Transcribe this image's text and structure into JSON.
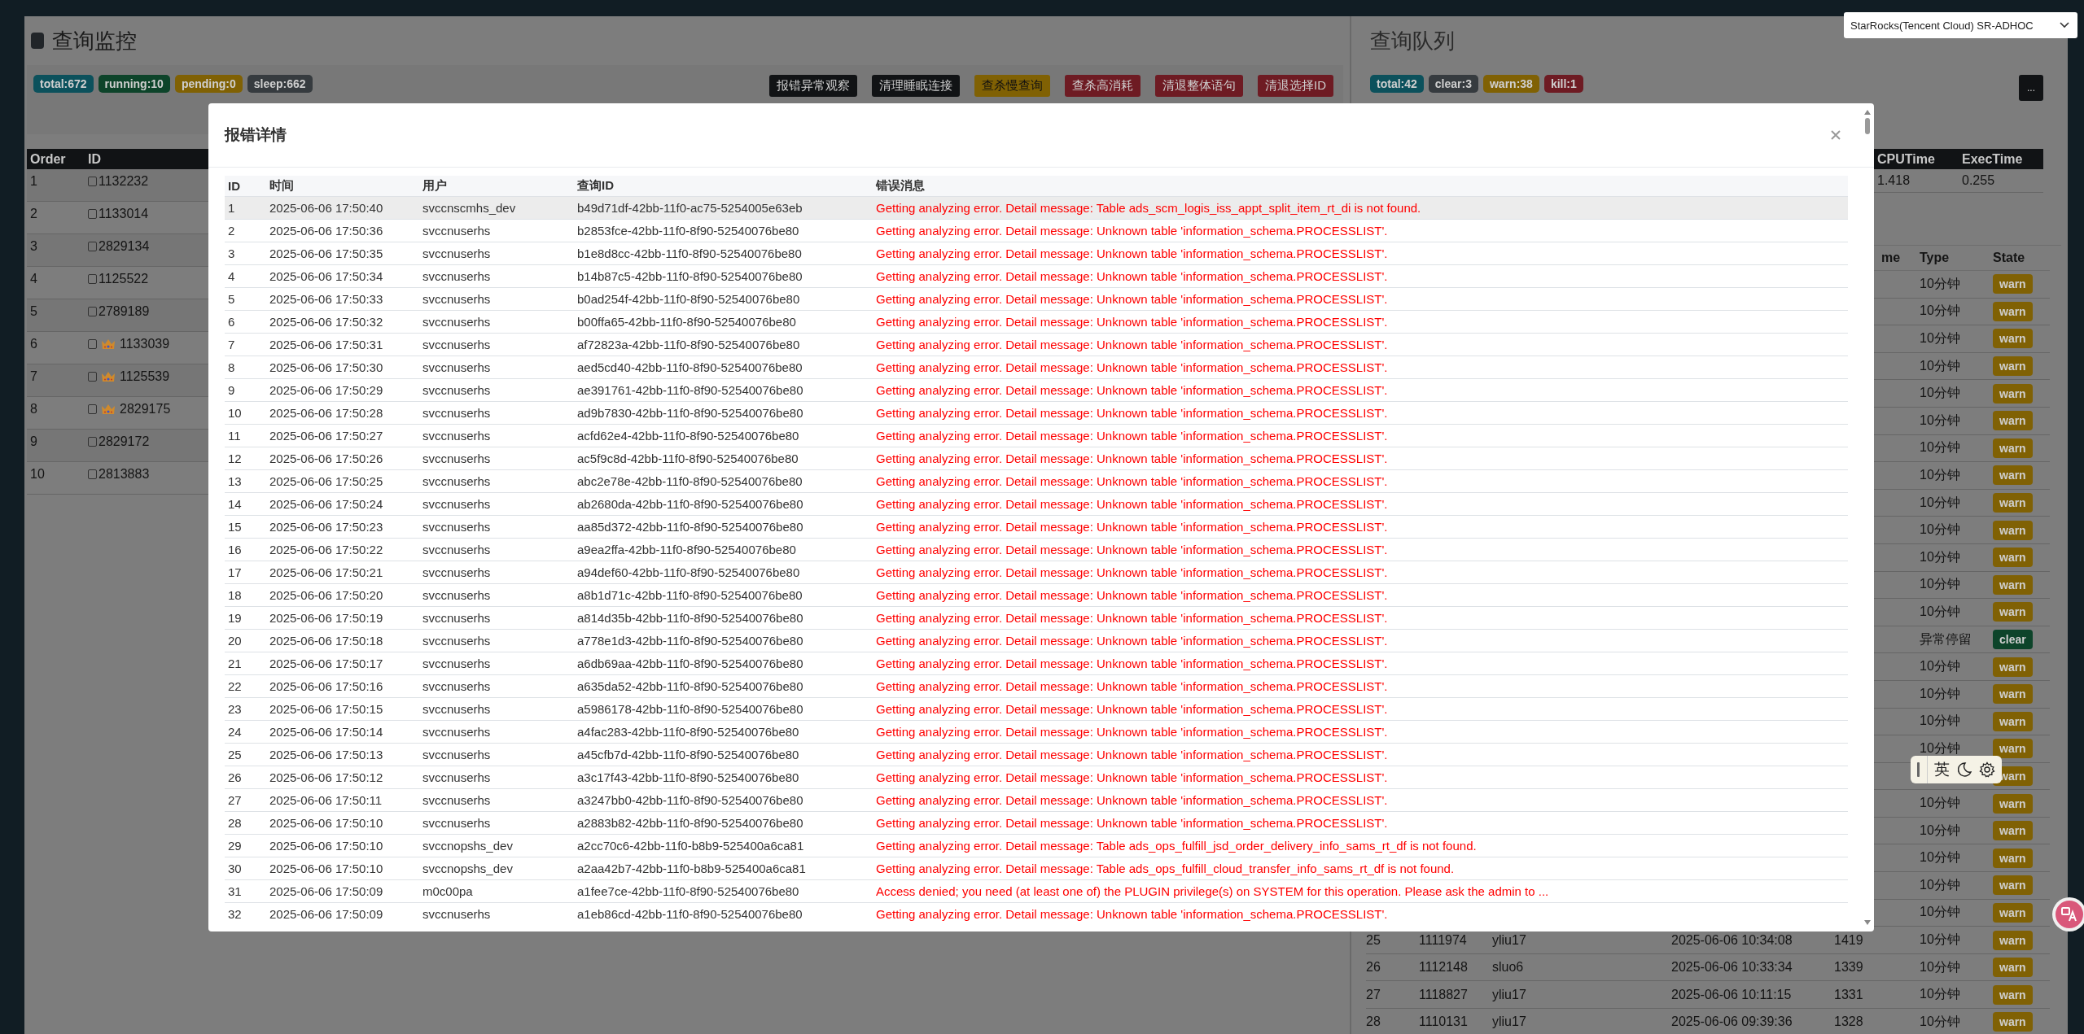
{
  "monitor": {
    "title": "查询监控",
    "badges": [
      {
        "label": "total:672",
        "color": "#0c515c"
      },
      {
        "label": "running:10",
        "color": "#0d442a"
      },
      {
        "label": "pending:0",
        "color": "#806104"
      },
      {
        "label": "sleep:662",
        "color": "#363b3f"
      }
    ],
    "buttons": [
      {
        "label": "报错异常观察",
        "color": "#111315"
      },
      {
        "label": "清理睡眠连接",
        "color": "#111315"
      },
      {
        "label": "查杀慢查询",
        "color": "#806104"
      },
      {
        "label": "查杀高消耗",
        "color": "#6e1b23"
      },
      {
        "label": "清退整体语句",
        "color": "#6e1b23"
      },
      {
        "label": "清退选择ID",
        "color": "#6e1b23"
      }
    ],
    "columns": [
      "Order",
      "ID"
    ],
    "rows": [
      {
        "order": "1",
        "id": "1132232",
        "checked": false,
        "crown": false
      },
      {
        "order": "2",
        "id": "1133014",
        "checked": false,
        "crown": false
      },
      {
        "order": "3",
        "id": "2829134",
        "checked": false,
        "crown": false
      },
      {
        "order": "4",
        "id": "1125522",
        "checked": false,
        "crown": false
      },
      {
        "order": "5",
        "id": "2789189",
        "checked": false,
        "crown": false
      },
      {
        "order": "6",
        "id": "1133039",
        "checked": false,
        "crown": true
      },
      {
        "order": "7",
        "id": "1125539",
        "checked": false,
        "crown": true
      },
      {
        "order": "8",
        "id": "2829175",
        "checked": false,
        "crown": true
      },
      {
        "order": "9",
        "id": "2829172",
        "checked": false,
        "crown": false
      },
      {
        "order": "10",
        "id": "2813883",
        "checked": false,
        "crown": false
      }
    ]
  },
  "queue": {
    "title": "查询队列",
    "badges": [
      {
        "label": "total:42",
        "color": "#0c515c"
      },
      {
        "label": "clear:3",
        "color": "#363b3f"
      },
      {
        "label": "warn:38",
        "color": "#806104"
      },
      {
        "label": "kill:1",
        "color": "#6e1b23"
      }
    ],
    "more_button": "...",
    "summary": {
      "columns": [
        "CPUTime",
        "ExecTime"
      ],
      "values": [
        "1.418",
        "0.255"
      ]
    },
    "columns": {
      "column_5": "me",
      "type": "Type",
      "state": "State"
    },
    "rows": [
      {
        "type": "10分钟",
        "state": "warn",
        "color": "#806104"
      },
      {
        "type": "10分钟",
        "state": "warn",
        "color": "#806104"
      },
      {
        "type": "10分钟",
        "state": "warn",
        "color": "#806104"
      },
      {
        "type": "10分钟",
        "state": "warn",
        "color": "#806104"
      },
      {
        "type": "10分钟",
        "state": "warn",
        "color": "#806104"
      },
      {
        "type": "10分钟",
        "state": "warn",
        "color": "#806104"
      },
      {
        "type": "10分钟",
        "state": "warn",
        "color": "#806104"
      },
      {
        "type": "10分钟",
        "state": "warn",
        "color": "#806104"
      },
      {
        "type": "10分钟",
        "state": "warn",
        "color": "#806104"
      },
      {
        "type": "10分钟",
        "state": "warn",
        "color": "#806104"
      },
      {
        "type": "10分钟",
        "state": "warn",
        "color": "#806104"
      },
      {
        "type": "10分钟",
        "state": "warn",
        "color": "#806104"
      },
      {
        "type": "10分钟",
        "state": "warn",
        "color": "#806104"
      },
      {
        "type": "异常停留",
        "state": "clear",
        "color": "#0d442a"
      },
      {
        "type": "10分钟",
        "state": "warn",
        "color": "#806104"
      },
      {
        "type": "10分钟",
        "state": "warn",
        "color": "#806104"
      },
      {
        "type": "10分钟",
        "state": "warn",
        "color": "#806104"
      },
      {
        "type": "10分钟",
        "state": "warn",
        "color": "#806104"
      },
      {
        "state": "warn",
        "color": "#806104"
      },
      {
        "type": "10分钟",
        "state": "warn",
        "color": "#806104"
      },
      {
        "type": "10分钟",
        "state": "warn",
        "color": "#806104"
      },
      {
        "type": "10分钟",
        "state": "warn",
        "color": "#806104"
      },
      {
        "type": "10分钟",
        "state": "warn",
        "color": "#806104"
      },
      {
        "type": "10分钟",
        "state": "warn",
        "color": "#806104"
      },
      {
        "order": "25",
        "id": "1111974",
        "user": "yliu17",
        "time": "2025-06-06 10:34:08",
        "column_5": "1419",
        "type": "10分钟",
        "state": "warn",
        "color": "#806104"
      },
      {
        "order": "26",
        "id": "1112148",
        "user": "sluo6",
        "time": "2025-06-06 10:33:34",
        "column_5": "1339",
        "type": "10分钟",
        "state": "warn",
        "color": "#806104"
      },
      {
        "order": "27",
        "id": "1118827",
        "user": "yliu17",
        "time": "2025-06-06 10:11:15",
        "column_5": "1331",
        "type": "10分钟",
        "state": "warn",
        "color": "#806104"
      },
      {
        "order": "28",
        "id": "1110131",
        "user": "yliu17",
        "time": "2025-06-06 09:39:36",
        "column_5": "1328",
        "type": "10分钟",
        "state": "warn",
        "color": "#806104"
      }
    ]
  },
  "cluster_select": {
    "value": "StarRocks(Tencent Cloud) SR-ADHOC"
  },
  "modal": {
    "title": "报错详情",
    "columns": [
      "ID",
      "时间",
      "用户",
      "查询ID",
      "错误消息"
    ],
    "rows": [
      {
        "id": "1",
        "time": "2025-06-06 17:50:40",
        "user": "svccnscmhs_dev",
        "query_id": "b49d71df-42bb-11f0-ac75-5254005e63eb",
        "message": "Getting analyzing error. Detail message: Table ads_scm_logis_iss_appt_split_item_rt_di is not found.",
        "selected": true
      },
      {
        "id": "2",
        "time": "2025-06-06 17:50:36",
        "user": "svccnuserhs",
        "query_id": "b2853fce-42bb-11f0-8f90-52540076be80",
        "message": "Getting analyzing error. Detail message: Unknown table 'information_schema.PROCESSLIST'.",
        "selected": false
      },
      {
        "id": "3",
        "time": "2025-06-06 17:50:35",
        "user": "svccnuserhs",
        "query_id": "b1e8d8cc-42bb-11f0-8f90-52540076be80",
        "message": "Getting analyzing error. Detail message: Unknown table 'information_schema.PROCESSLIST'.",
        "selected": false
      },
      {
        "id": "4",
        "time": "2025-06-06 17:50:34",
        "user": "svccnuserhs",
        "query_id": "b14b87c5-42bb-11f0-8f90-52540076be80",
        "message": "Getting analyzing error. Detail message: Unknown table 'information_schema.PROCESSLIST'.",
        "selected": false
      },
      {
        "id": "5",
        "time": "2025-06-06 17:50:33",
        "user": "svccnuserhs",
        "query_id": "b0ad254f-42bb-11f0-8f90-52540076be80",
        "message": "Getting analyzing error. Detail message: Unknown table 'information_schema.PROCESSLIST'.",
        "selected": false
      },
      {
        "id": "6",
        "time": "2025-06-06 17:50:32",
        "user": "svccnuserhs",
        "query_id": "b00ffa65-42bb-11f0-8f90-52540076be80",
        "message": "Getting analyzing error. Detail message: Unknown table 'information_schema.PROCESSLIST'.",
        "selected": false
      },
      {
        "id": "7",
        "time": "2025-06-06 17:50:31",
        "user": "svccnuserhs",
        "query_id": "af72823a-42bb-11f0-8f90-52540076be80",
        "message": "Getting analyzing error. Detail message: Unknown table 'information_schema.PROCESSLIST'.",
        "selected": false
      },
      {
        "id": "8",
        "time": "2025-06-06 17:50:30",
        "user": "svccnuserhs",
        "query_id": "aed5cd40-42bb-11f0-8f90-52540076be80",
        "message": "Getting analyzing error. Detail message: Unknown table 'information_schema.PROCESSLIST'.",
        "selected": false
      },
      {
        "id": "9",
        "time": "2025-06-06 17:50:29",
        "user": "svccnuserhs",
        "query_id": "ae391761-42bb-11f0-8f90-52540076be80",
        "message": "Getting analyzing error. Detail message: Unknown table 'information_schema.PROCESSLIST'.",
        "selected": false
      },
      {
        "id": "10",
        "time": "2025-06-06 17:50:28",
        "user": "svccnuserhs",
        "query_id": "ad9b7830-42bb-11f0-8f90-52540076be80",
        "message": "Getting analyzing error. Detail message: Unknown table 'information_schema.PROCESSLIST'.",
        "selected": false
      },
      {
        "id": "11",
        "time": "2025-06-06 17:50:27",
        "user": "svccnuserhs",
        "query_id": "acfd62e4-42bb-11f0-8f90-52540076be80",
        "message": "Getting analyzing error. Detail message: Unknown table 'information_schema.PROCESSLIST'.",
        "selected": false
      },
      {
        "id": "12",
        "time": "2025-06-06 17:50:26",
        "user": "svccnuserhs",
        "query_id": "ac5f9c8d-42bb-11f0-8f90-52540076be80",
        "message": "Getting analyzing error. Detail message: Unknown table 'information_schema.PROCESSLIST'.",
        "selected": false
      },
      {
        "id": "13",
        "time": "2025-06-06 17:50:25",
        "user": "svccnuserhs",
        "query_id": "abc2e78e-42bb-11f0-8f90-52540076be80",
        "message": "Getting analyzing error. Detail message: Unknown table 'information_schema.PROCESSLIST'.",
        "selected": false
      },
      {
        "id": "14",
        "time": "2025-06-06 17:50:24",
        "user": "svccnuserhs",
        "query_id": "ab2680da-42bb-11f0-8f90-52540076be80",
        "message": "Getting analyzing error. Detail message: Unknown table 'information_schema.PROCESSLIST'.",
        "selected": false
      },
      {
        "id": "15",
        "time": "2025-06-06 17:50:23",
        "user": "svccnuserhs",
        "query_id": "aa85d372-42bb-11f0-8f90-52540076be80",
        "message": "Getting analyzing error. Detail message: Unknown table 'information_schema.PROCESSLIST'.",
        "selected": false
      },
      {
        "id": "16",
        "time": "2025-06-06 17:50:22",
        "user": "svccnuserhs",
        "query_id": "a9ea2ffa-42bb-11f0-8f90-52540076be80",
        "message": "Getting analyzing error. Detail message: Unknown table 'information_schema.PROCESSLIST'.",
        "selected": false
      },
      {
        "id": "17",
        "time": "2025-06-06 17:50:21",
        "user": "svccnuserhs",
        "query_id": "a94def60-42bb-11f0-8f90-52540076be80",
        "message": "Getting analyzing error. Detail message: Unknown table 'information_schema.PROCESSLIST'.",
        "selected": false
      },
      {
        "id": "18",
        "time": "2025-06-06 17:50:20",
        "user": "svccnuserhs",
        "query_id": "a8b1d71c-42bb-11f0-8f90-52540076be80",
        "message": "Getting analyzing error. Detail message: Unknown table 'information_schema.PROCESSLIST'.",
        "selected": false
      },
      {
        "id": "19",
        "time": "2025-06-06 17:50:19",
        "user": "svccnuserhs",
        "query_id": "a814d35b-42bb-11f0-8f90-52540076be80",
        "message": "Getting analyzing error. Detail message: Unknown table 'information_schema.PROCESSLIST'.",
        "selected": false
      },
      {
        "id": "20",
        "time": "2025-06-06 17:50:18",
        "user": "svccnuserhs",
        "query_id": "a778e1d3-42bb-11f0-8f90-52540076be80",
        "message": "Getting analyzing error. Detail message: Unknown table 'information_schema.PROCESSLIST'.",
        "selected": false
      },
      {
        "id": "21",
        "time": "2025-06-06 17:50:17",
        "user": "svccnuserhs",
        "query_id": "a6db69aa-42bb-11f0-8f90-52540076be80",
        "message": "Getting analyzing error. Detail message: Unknown table 'information_schema.PROCESSLIST'.",
        "selected": false
      },
      {
        "id": "22",
        "time": "2025-06-06 17:50:16",
        "user": "svccnuserhs",
        "query_id": "a635da52-42bb-11f0-8f90-52540076be80",
        "message": "Getting analyzing error. Detail message: Unknown table 'information_schema.PROCESSLIST'.",
        "selected": false
      },
      {
        "id": "23",
        "time": "2025-06-06 17:50:15",
        "user": "svccnuserhs",
        "query_id": "a5986178-42bb-11f0-8f90-52540076be80",
        "message": "Getting analyzing error. Detail message: Unknown table 'information_schema.PROCESSLIST'.",
        "selected": false
      },
      {
        "id": "24",
        "time": "2025-06-06 17:50:14",
        "user": "svccnuserhs",
        "query_id": "a4fac283-42bb-11f0-8f90-52540076be80",
        "message": "Getting analyzing error. Detail message: Unknown table 'information_schema.PROCESSLIST'.",
        "selected": false
      },
      {
        "id": "25",
        "time": "2025-06-06 17:50:13",
        "user": "svccnuserhs",
        "query_id": "a45cfb7d-42bb-11f0-8f90-52540076be80",
        "message": "Getting analyzing error. Detail message: Unknown table 'information_schema.PROCESSLIST'.",
        "selected": false
      },
      {
        "id": "26",
        "time": "2025-06-06 17:50:12",
        "user": "svccnuserhs",
        "query_id": "a3c17f43-42bb-11f0-8f90-52540076be80",
        "message": "Getting analyzing error. Detail message: Unknown table 'information_schema.PROCESSLIST'.",
        "selected": false
      },
      {
        "id": "27",
        "time": "2025-06-06 17:50:11",
        "user": "svccnuserhs",
        "query_id": "a3247bb0-42bb-11f0-8f90-52540076be80",
        "message": "Getting analyzing error. Detail message: Unknown table 'information_schema.PROCESSLIST'.",
        "selected": false
      },
      {
        "id": "28",
        "time": "2025-06-06 17:50:10",
        "user": "svccnuserhs",
        "query_id": "a2883b82-42bb-11f0-8f90-52540076be80",
        "message": "Getting analyzing error. Detail message: Unknown table 'information_schema.PROCESSLIST'.",
        "selected": false
      },
      {
        "id": "29",
        "time": "2025-06-06 17:50:10",
        "user": "svccnopshs_dev",
        "query_id": "a2cc70c6-42bb-11f0-b8b9-525400a6ca81",
        "message": "Getting analyzing error. Detail message: Table ads_ops_fulfill_jsd_order_delivery_info_sams_rt_df is not found.",
        "selected": false
      },
      {
        "id": "30",
        "time": "2025-06-06 17:50:10",
        "user": "svccnopshs_dev",
        "query_id": "a2aa42b7-42bb-11f0-b8b9-525400a6ca81",
        "message": "Getting analyzing error. Detail message: Table ads_ops_fulfill_cloud_transfer_info_sams_rt_df is not found.",
        "selected": false
      },
      {
        "id": "31",
        "time": "2025-06-06 17:50:09",
        "user": "m0c00pa",
        "query_id": "a1fee7ce-42bb-11f0-8f90-52540076be80",
        "message": "Access denied; you need (at least one of) the PLUGIN privilege(s) on SYSTEM for this operation. Please ask the admin to ...",
        "selected": false
      },
      {
        "id": "32",
        "time": "2025-06-06 17:50:09",
        "user": "svccnuserhs",
        "query_id": "a1eb86cd-42bb-11f0-8f90-52540076be80",
        "message": "Getting analyzing error. Detail message: Unknown table 'information_schema.PROCESSLIST'.",
        "selected": false
      }
    ]
  },
  "ime": {
    "language": "英"
  }
}
